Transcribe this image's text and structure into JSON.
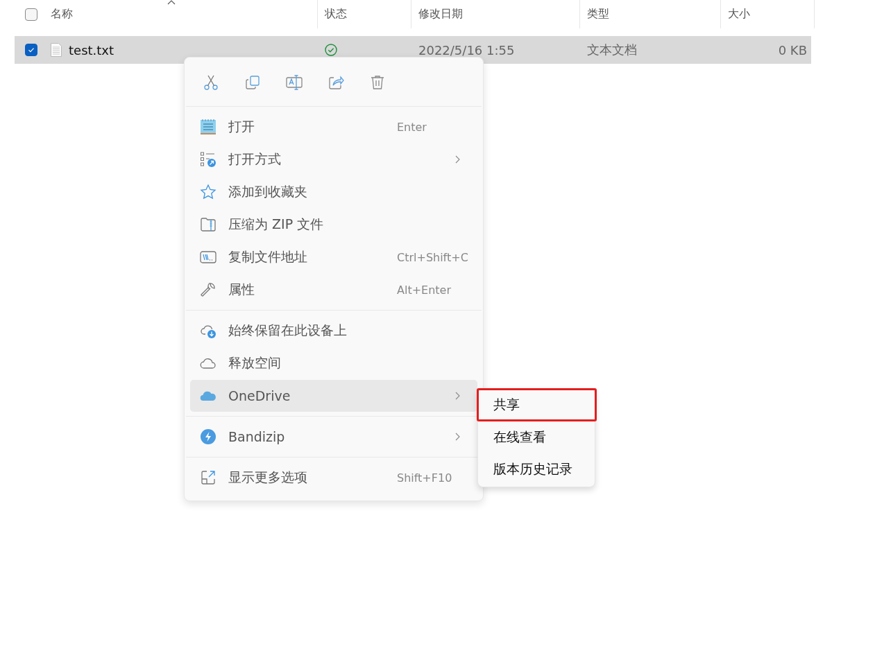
{
  "columns": [
    {
      "label": "名称",
      "sorted": true
    },
    {
      "label": "状态",
      "sorted": false
    },
    {
      "label": "修改日期",
      "sorted": false
    },
    {
      "label": "类型",
      "sorted": false
    },
    {
      "label": "大小",
      "sorted": false
    }
  ],
  "header_checkbox": {
    "checked": false
  },
  "rows": [
    {
      "checked": true,
      "selected": true,
      "name": "test.txt",
      "date": "2022/5/16 1:55",
      "type": "文本文档",
      "size": "0 KB"
    }
  ],
  "context_menu": {
    "toolbar": [
      {
        "kind": "cut"
      },
      {
        "kind": "copy"
      },
      {
        "kind": "rename"
      },
      {
        "kind": "share"
      },
      {
        "kind": "delete"
      }
    ],
    "groups": [
      [
        {
          "kind": "notepad",
          "label": "打开",
          "shortcut": "Enter",
          "submenu": false,
          "selected": false
        },
        {
          "kind": "openwith",
          "label": "打开方式",
          "submenu": true,
          "selected": false
        },
        {
          "kind": "star",
          "label": "添加到收藏夹",
          "submenu": false,
          "selected": false
        },
        {
          "kind": "zip",
          "label": "压缩为 ZIP 文件",
          "submenu": false,
          "selected": false
        },
        {
          "kind": "path",
          "label": "复制文件地址",
          "shortcut": "Ctrl+Shift+C",
          "submenu": false,
          "selected": false
        },
        {
          "kind": "wrench",
          "label": "属性",
          "shortcut": "Alt+Enter",
          "submenu": false,
          "selected": false
        }
      ],
      [
        {
          "kind": "clouddown",
          "label": "始终保留在此设备上",
          "submenu": false,
          "selected": false
        },
        {
          "kind": "cloud",
          "label": "释放空间",
          "submenu": false,
          "selected": false
        },
        {
          "kind": "onedrive",
          "label": "OneDrive",
          "submenu": true,
          "selected": true
        }
      ],
      [
        {
          "kind": "bandizip",
          "label": "Bandizip",
          "submenu": true,
          "selected": false
        }
      ],
      [
        {
          "kind": "more",
          "label": "显示更多选项",
          "shortcut": "Shift+F10",
          "submenu": false,
          "selected": false
        }
      ]
    ]
  },
  "submenu": [
    {
      "label": "共享",
      "selected": true
    },
    {
      "label": "在线查看",
      "selected": false
    },
    {
      "label": "版本历史记录",
      "selected": false
    }
  ]
}
